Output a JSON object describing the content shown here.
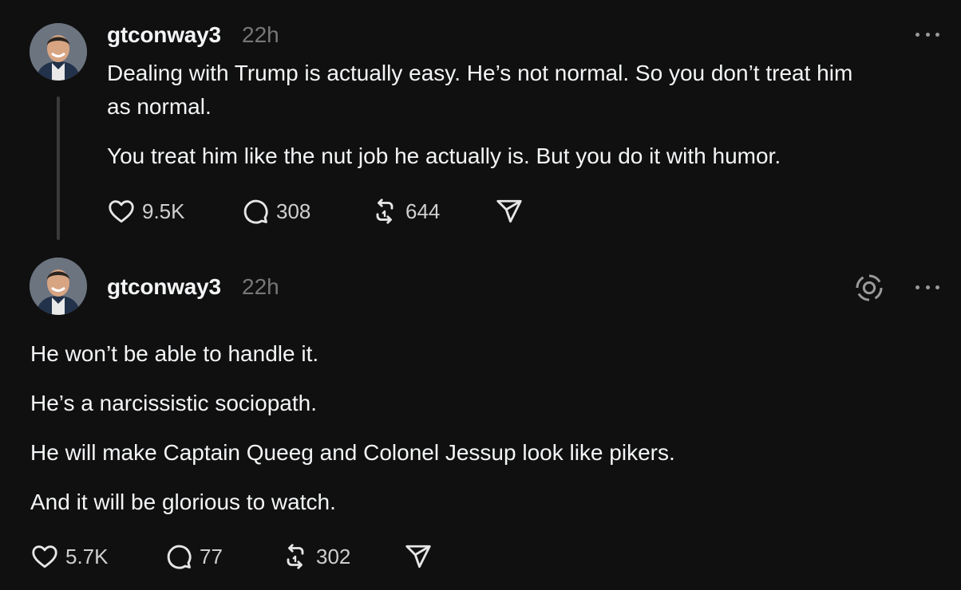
{
  "posts": [
    {
      "author": "gtconway3",
      "time": "22h",
      "paragraphs": [
        "Dealing with Trump is actually easy. He’s not normal. So you don’t treat him",
        "as normal.",
        "You treat him like the nut job he actually is. But you do it with humor."
      ],
      "likes": "9.5K",
      "replies": "308",
      "reposts": "644"
    },
    {
      "author": "gtconway3",
      "time": "22h",
      "paragraphs": [
        "He won’t be able to handle it.",
        "He’s a narcissistic sociopath.",
        "He will make Captain Queeg and Colonel Jessup look like pikers.",
        "And it will be glorious to watch."
      ],
      "likes": "5.7K",
      "replies": "77",
      "reposts": "302"
    }
  ],
  "icons": {
    "like": "heart-icon",
    "reply": "comment-icon",
    "repost": "repost-icon",
    "share": "send-icon",
    "more": "more-icon",
    "activity": "activity-ring-icon"
  },
  "colors": {
    "background": "#101010",
    "text": "#f3f5f7",
    "muted": "#777777",
    "thread_line": "#3a3a3a"
  }
}
